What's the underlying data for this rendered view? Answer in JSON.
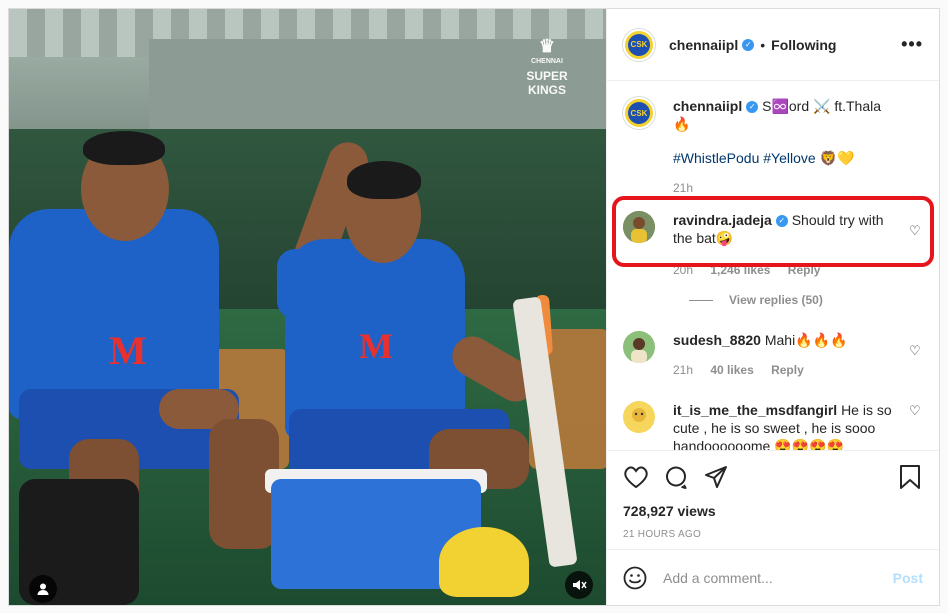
{
  "media": {
    "watermark_line1": "CHENNAI",
    "watermark_line2": "SUPER",
    "watermark_line3": "KINGS"
  },
  "header": {
    "username": "chennaiipl",
    "separator": "•",
    "follow_label": "Following",
    "more_label": "•••"
  },
  "caption": {
    "username": "chennaiipl",
    "text": "S♾️ord ⚔️ ft.Thala 🔥",
    "hashtags": "#WhistlePodu #Yellove 🦁💛",
    "time": "21h"
  },
  "comments": [
    {
      "username": "ravindra.jadeja",
      "text": "Should try with the bat🤪",
      "time": "20h",
      "likes": "1,246 likes",
      "reply_label": "Reply",
      "view_replies": "View replies (50)"
    },
    {
      "username": "sudesh_8820",
      "text": "Mahi🔥🔥🔥",
      "time": "21h",
      "likes": "40 likes",
      "reply_label": "Reply"
    },
    {
      "username": "it_is_me_the_msdfangirl",
      "text": "He is so cute , he is so sweet , he is sooo handoooooome 😍😍😍😍"
    }
  ],
  "stats": {
    "views": "728,927 views",
    "posted": "21 HOURS AGO"
  },
  "add_comment": {
    "placeholder": "Add a comment...",
    "post_label": "Post"
  },
  "colors": {
    "highlight": "#e6151c",
    "verified": "#3897f0",
    "hashtag": "#00376b",
    "post_disabled": "#b2dffc"
  }
}
